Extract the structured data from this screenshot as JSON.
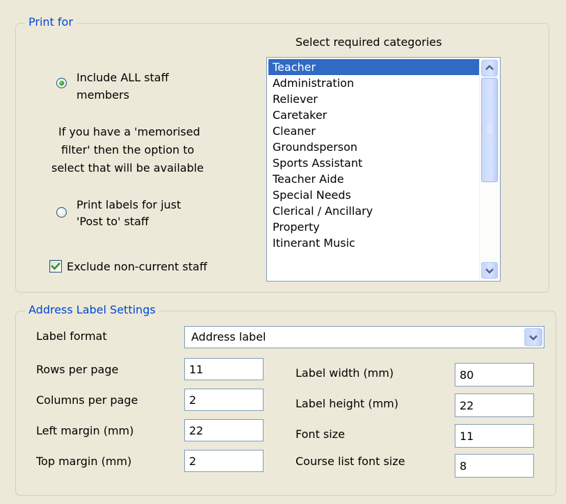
{
  "print_for": {
    "title": "Print for",
    "include_all_label_line1": "Include ALL staff",
    "include_all_label_line2": "members",
    "memorised_note_line1": "If you have a 'memorised",
    "memorised_note_line2": "filter' then the option to",
    "memorised_note_line3": "select that will be available",
    "post_to_label_line1": "Print labels for just",
    "post_to_label_line2": "'Post to' staff",
    "exclude_label": "Exclude non-current staff",
    "include_all_selected": true,
    "exclude_checked": true,
    "categories_heading": "Select required categories",
    "categories": [
      "Teacher",
      "Administration",
      "Reliever",
      "Caretaker",
      "Cleaner",
      "Groundsperson",
      "Sports Assistant",
      "Teacher Aide",
      "Special Needs",
      "Clerical / Ancillary",
      "Property",
      "Itinerant Music"
    ],
    "selected_category": "Teacher"
  },
  "address_settings": {
    "title": "Address Label Settings",
    "label_format_label": "Label format",
    "label_format_value": "Address label",
    "rows_label": "Rows per page",
    "rows_value": "11",
    "columns_label": "Columns per page",
    "columns_value": "2",
    "left_margin_label": "Left margin (mm)",
    "left_margin_value": "22",
    "top_margin_label": "Top margin (mm)",
    "top_margin_value": "2",
    "label_width_label": "Label width (mm)",
    "label_width_value": "80",
    "label_height_label": "Label height (mm)",
    "label_height_value": "22",
    "font_size_label": "Font size",
    "font_size_value": "11",
    "course_font_label": "Course list font size",
    "course_font_value": "8"
  },
  "colors": {
    "background": "#ECE9D8",
    "group_title": "#0046D5",
    "selection": "#316AC5",
    "border": "#7F9DB9"
  },
  "icons": {
    "scroll_up": "chevron-up-icon",
    "scroll_down": "chevron-down-icon",
    "dropdown": "chevron-down-icon",
    "check": "checkmark-icon"
  }
}
